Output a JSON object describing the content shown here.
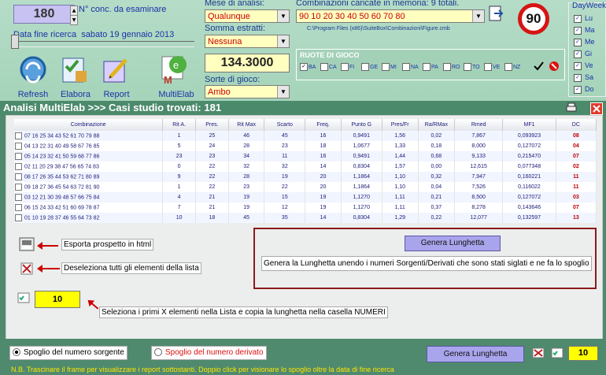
{
  "header": {
    "conc_value": "180",
    "conc_label": "N° conc. da esaminare",
    "date_label": "Data fine ricerca",
    "date_value": "sabato 19 gennaio 2013",
    "mese_label": "Mese di analisi:",
    "mese_value": "Qualunque",
    "somma_label": "Somma estratti:",
    "somma_value": "Nessuna",
    "score_value": "134.3000",
    "sorte_label": "Sorte di gioco:",
    "sorte_value": "Ambo",
    "comb_label": "Combinazioni caricate in memoria: 9 totali.",
    "comb_value": "90 10 20 30 40 50 60 70 80",
    "path": "C:\\Program Files (x86)\\SuiteBox\\Combinazioni\\Figure.cmb",
    "sign_value": "90"
  },
  "toolbar": [
    {
      "label": "Refresh",
      "icon": "refresh-icon"
    },
    {
      "label": "Elabora",
      "icon": "elabora-icon"
    },
    {
      "label": "Report",
      "icon": "report-icon"
    },
    {
      "label": "MultiElab",
      "icon": "multielab-icon"
    }
  ],
  "ruote": {
    "title": "RUOTE DI GIOCO",
    "items": [
      "BA",
      "CA",
      "FI",
      "GE",
      "MI",
      "NA",
      "PA",
      "RO",
      "TO",
      "VE",
      "NZ"
    ],
    "checked": [
      "BA"
    ]
  },
  "dayweek": {
    "title": "DayWeek",
    "items": [
      "Lu",
      "Ma",
      "Me",
      "Gi",
      "Ve",
      "Sa",
      "Do"
    ]
  },
  "title_bar": "Analisi MultiElab >>> Casi studio trovati: 181",
  "table": {
    "columns": [
      "Combinazione",
      "Rit A.",
      "Pres.",
      "Rit Max",
      "Scarto",
      "Freq.",
      "Punto G",
      "Pres/Fr",
      "Ra/RMax",
      "Rmed",
      "MF1",
      "DC"
    ],
    "rows": [
      [
        "07 16 25 34 43 52 61 70 79 88",
        "1",
        "25",
        "46",
        "45",
        "16",
        "0,9491",
        "1,56",
        "0,02",
        "7,867",
        "0,093923",
        "08"
      ],
      [
        "04 13 22 31 40 49 58 67 76 85",
        "5",
        "24",
        "28",
        "23",
        "18",
        "1,0677",
        "1,33",
        "0,18",
        "8,000",
        "0,127072",
        "04"
      ],
      [
        "05 14 23 32 41 50 59 68 77 86",
        "23",
        "23",
        "34",
        "11",
        "16",
        "0,9491",
        "1,44",
        "0,68",
        "9,133",
        "0,215470",
        "07"
      ],
      [
        "02 11 20 29 38 47 56 65 74 83",
        "0",
        "22",
        "32",
        "32",
        "14",
        "0,8304",
        "1,57",
        "0,00",
        "12,615",
        "0,077348",
        "02"
      ],
      [
        "08 17 26 35 44 53 62 71 80 89",
        "9",
        "22",
        "28",
        "19",
        "20",
        "1,1864",
        "1,10",
        "0,32",
        "7,947",
        "0,160221",
        "11"
      ],
      [
        "09 18 27 36 45 54 63 72 81 90",
        "1",
        "22",
        "23",
        "22",
        "20",
        "1,1864",
        "1,10",
        "0,04",
        "7,526",
        "0,116022",
        "11"
      ],
      [
        "03 12 21 30 39 48 57 66 75 84",
        "4",
        "21",
        "19",
        "15",
        "19",
        "1,1270",
        "1,11",
        "0,21",
        "8,500",
        "0,127072",
        "03"
      ],
      [
        "06 15 24 33 42 51 60 69 78 87",
        "7",
        "21",
        "19",
        "12",
        "19",
        "1,1270",
        "1,11",
        "0,37",
        "8,278",
        "0,143646",
        "07"
      ],
      [
        "01 10 19 28 37 46 55 64 73 82",
        "10",
        "18",
        "45",
        "35",
        "14",
        "0,8304",
        "1,29",
        "0,22",
        "12,077",
        "0,132597",
        "13"
      ]
    ]
  },
  "annotations": {
    "html": "Esporta prospetto in html",
    "deselect": "Deseleziona tutti gli elementi della lista",
    "select_x": "Seleziona i primi X elementi nella Lista e copia la lunghetta nella casella NUMERI",
    "genera_desc": "Genera  la Lunghetta unendo i numeri Sorgenti/Derivati che sono stati siglati e ne fa lo spoglio",
    "x_value": "10"
  },
  "buttons": {
    "genera": "Genera Lunghetta",
    "genera_bottom": "Genera Lunghetta"
  },
  "bottom": {
    "radio1": "Spoglio del numero sorgente",
    "radio2": "Spoglio del numero derivato",
    "x_value": "10",
    "note": "N.B. Trascinare il frame per visualizzare i report sottostanti. Doppio click per visionare lo spoglio oltre la data di fine ricerca"
  }
}
